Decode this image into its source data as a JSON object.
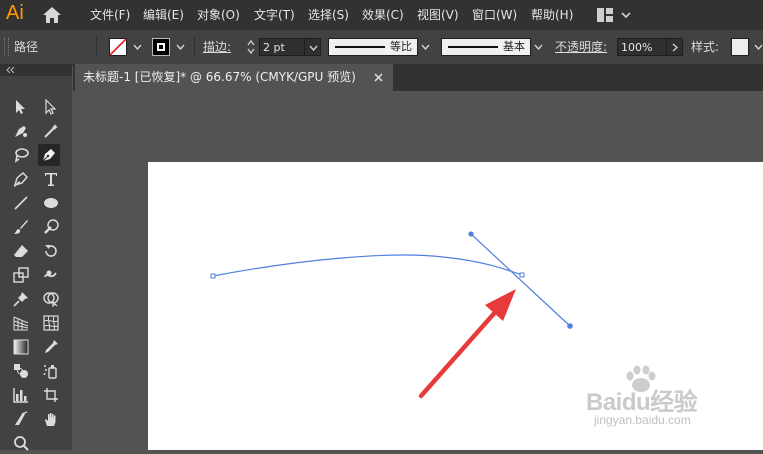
{
  "app": {
    "logo": "Ai"
  },
  "menu": [
    "文件(F)",
    "编辑(E)",
    "对象(O)",
    "文字(T)",
    "选择(S)",
    "效果(C)",
    "视图(V)",
    "窗口(W)",
    "帮助(H)"
  ],
  "control_bar": {
    "selection_label": "路径",
    "stroke_label": "描边",
    "stroke_weight": "2 pt",
    "profile_label": "等比",
    "brush_label": "基本",
    "opacity_label": "不透明度",
    "opacity_value": "100%",
    "style_label": "样式"
  },
  "document_tab": {
    "title": "未标题-1 [已恢复]* @ 66.67% (CMYK/GPU 预览)"
  },
  "colors": {
    "menubar": "#323232",
    "panel": "#424242",
    "canvas_bg": "#535353",
    "path": "#4f7fe0",
    "arrow": "#e83a3a",
    "logo": "#ff9a00"
  },
  "watermark": {
    "brand": "Baidu经验",
    "url": "jingyan.baidu.com"
  }
}
